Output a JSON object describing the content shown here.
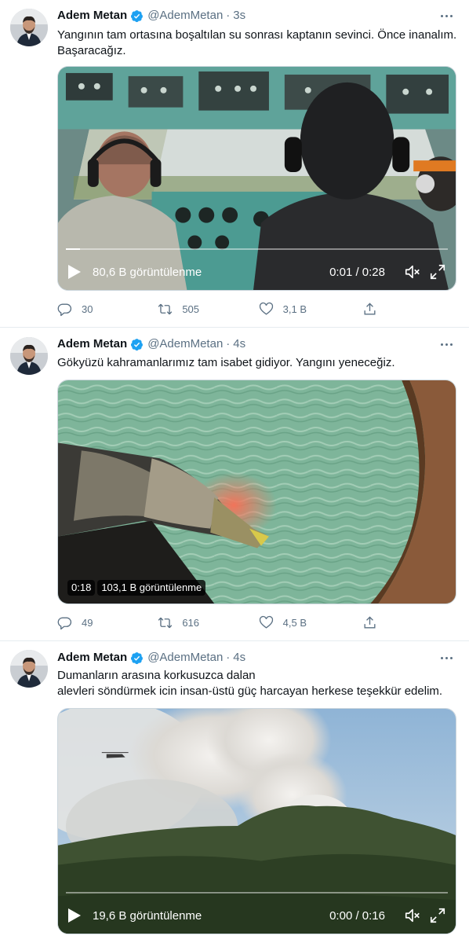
{
  "tweets": [
    {
      "author": {
        "name": "Adem Metan",
        "handle": "@AdemMetan",
        "time": "3s"
      },
      "text": "Yangının tam ortasına boşaltılan su sonrası kaptanın sevinci. Önce inanalım.\nBaşaracağız.",
      "video": {
        "views": "80,6 B görüntülenme",
        "duration": "0:01 / 0:28",
        "progress": 0.036
      },
      "stats": {
        "replies": "30",
        "retweets": "505",
        "likes": "3,1 B"
      }
    },
    {
      "author": {
        "name": "Adem Metan",
        "handle": "@AdemMetan",
        "time": "4s"
      },
      "text": "Gökyüzü kahramanlarımız tam isabet gidiyor. Yangını yeneceğiz.",
      "video": {
        "time": "0:18",
        "views": "103,1 B görüntülenme"
      },
      "stats": {
        "replies": "49",
        "retweets": "616",
        "likes": "4,5 B"
      }
    },
    {
      "author": {
        "name": "Adem Metan",
        "handle": "@AdemMetan",
        "time": "4s"
      },
      "text": "Dumanların arasına korkusuzca dalan\nalevleri söndürmek icin insan-üstü güç harcayan herkese teşekkür edelim.",
      "video": {
        "views": "19,6 B görüntülenme",
        "duration": "0:00 / 0:16",
        "progress": 0.0
      }
    }
  ],
  "icons": {
    "verified": "verified-badge-icon",
    "more": "more-icon",
    "reply": "reply-icon",
    "retweet": "retweet-icon",
    "like": "like-icon",
    "share": "share-icon",
    "play": "play-icon",
    "mute": "mute-icon",
    "fullscreen": "fullscreen-icon"
  },
  "colors": {
    "accent": "#1da1f2",
    "secondary_text": "#5b7083",
    "border": "#e6ecf0"
  }
}
